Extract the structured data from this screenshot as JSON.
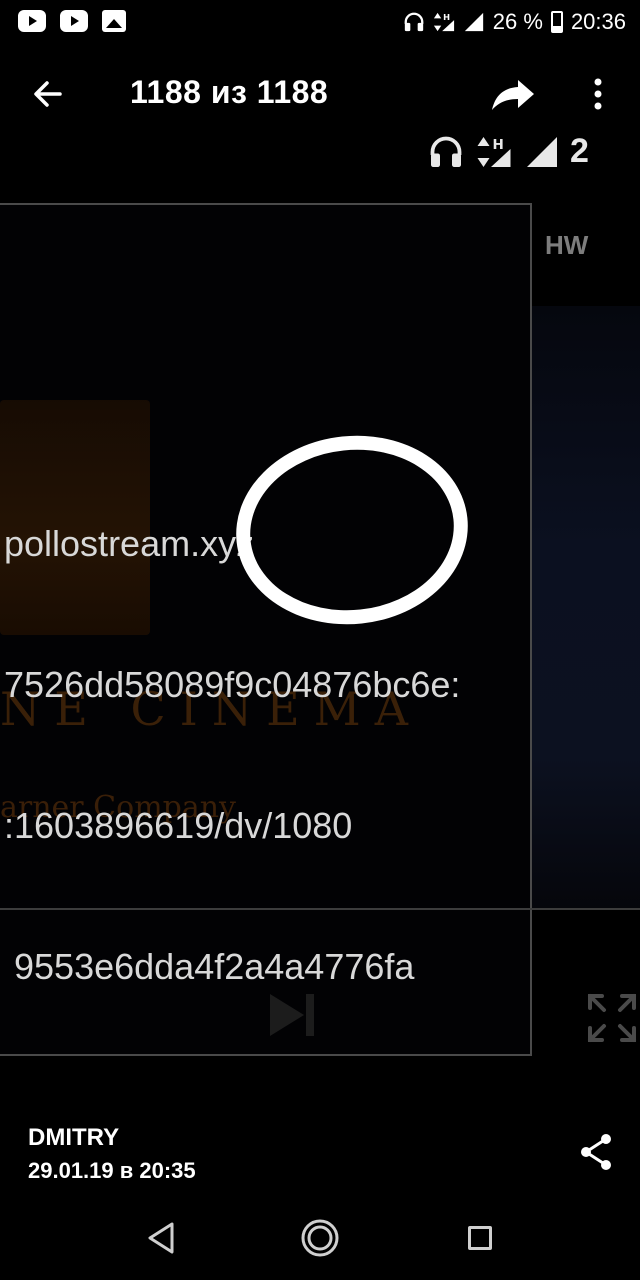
{
  "status_bar": {
    "battery_percent": "26 %",
    "time": "20:36",
    "icons": [
      "youtube-icon",
      "youtube-icon",
      "gallery-icon",
      "headphones-icon",
      "data-arrows-icon",
      "signal-icon",
      "signal-icon",
      "battery-icon"
    ]
  },
  "app_bar": {
    "title": "1188 из 1188",
    "icons": [
      "back-arrow-icon",
      "share-forward-icon",
      "more-vert-icon"
    ]
  },
  "photo": {
    "ghost_status_text": "2",
    "hw_label": "HW",
    "url_lines": [
      "pollostream.xyz",
      "7526dd58089f9c04876bc6e:",
      ":1603896619/dv/1080",
      " 9553e6dda4f2a4a4776fa"
    ],
    "cinema_text": "NE CINEMA",
    "company_text": "arner Company"
  },
  "footer": {
    "author": "DMITRY",
    "date": "29.01.19 в 20:35"
  },
  "nav_bar": {
    "icons": [
      "nav-back-icon",
      "nav-home-icon",
      "nav-recents-icon"
    ]
  },
  "colors": {
    "background": "#000000",
    "text": "#ffffff",
    "annotation_circle": "#ffffff",
    "frame_border": "#4a4a4a"
  }
}
